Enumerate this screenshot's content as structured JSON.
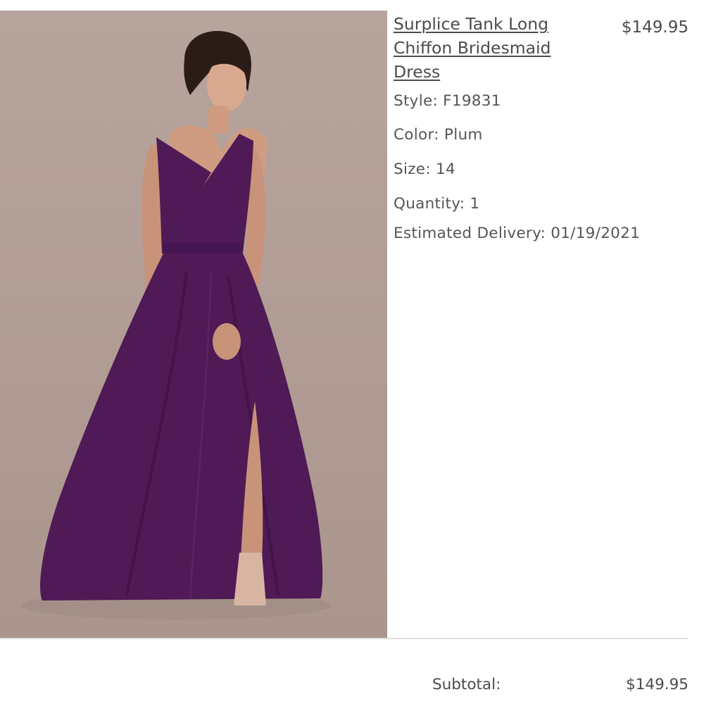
{
  "product": {
    "title": "Surplice Tank Long Chiffon Bridesmaid Dress",
    "price": "$149.95",
    "image_icon": "dress-photo",
    "style": "Style: F19831",
    "color": "Color: Plum",
    "size": "Size: 14",
    "quantity": "Quantity: 1",
    "delivery": "Estimated Delivery: 01/19/2021"
  },
  "summary": {
    "subtotal_label": "Subtotal:",
    "subtotal_value": "$149.95"
  },
  "colors": {
    "dress": "#4f1a55",
    "background": "#b09c94"
  }
}
